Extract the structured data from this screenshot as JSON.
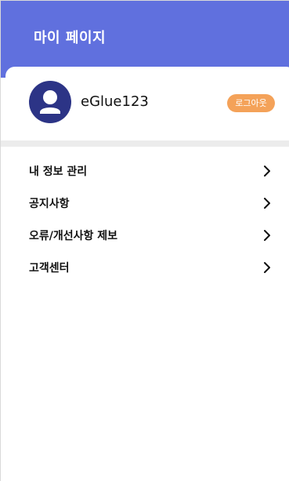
{
  "header": {
    "title": "마이 페이지"
  },
  "profile": {
    "avatar_icon": "user-avatar-icon",
    "username": "eGlue123",
    "logout_label": "로그아웃"
  },
  "menu": {
    "items": [
      {
        "label": "내 정보 관리",
        "icon": "chevron-right-icon"
      },
      {
        "label": "공지사항",
        "icon": "chevron-right-icon"
      },
      {
        "label": "오류/개선사항 제보",
        "icon": "chevron-right-icon"
      },
      {
        "label": "고객센터",
        "icon": "chevron-right-icon"
      }
    ]
  },
  "colors": {
    "header_bg": "#6070de",
    "avatar_bg": "#2c3486",
    "logout_bg": "#f4a259",
    "divider": "#ececec"
  }
}
